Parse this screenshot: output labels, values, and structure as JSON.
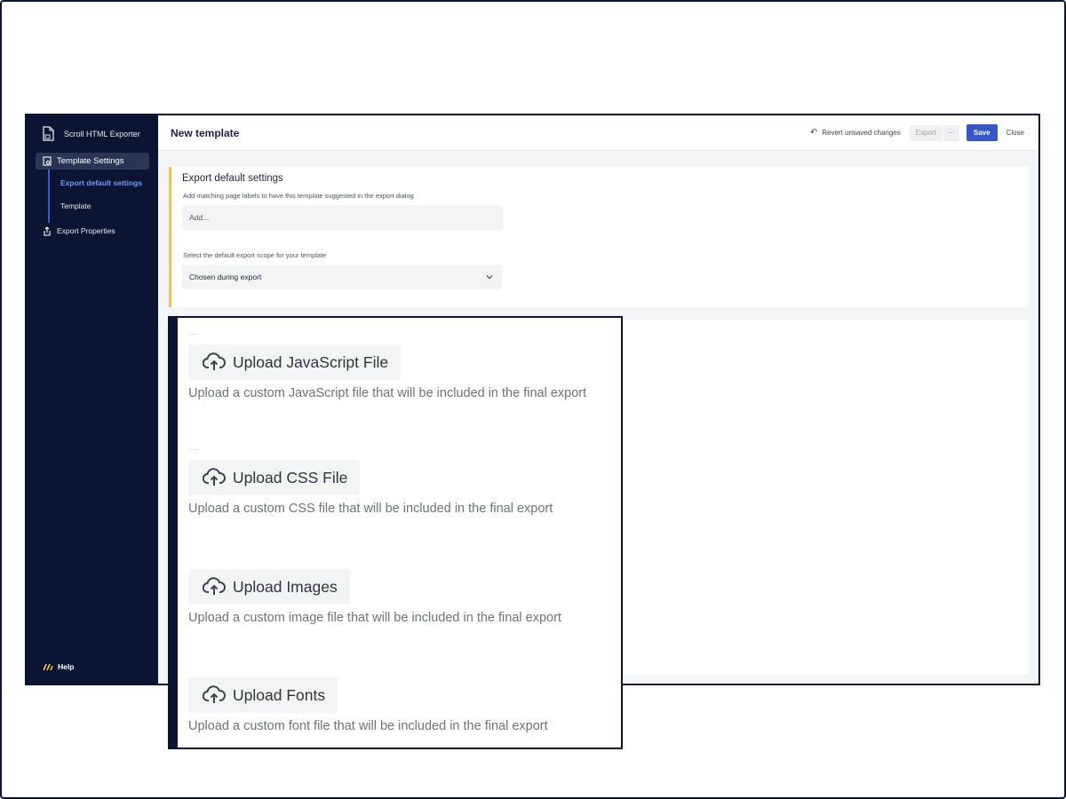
{
  "sidebar": {
    "app_name": "Scroll HTML Exporter",
    "nav_active": "Template Settings",
    "sub_items": [
      "Export default settings",
      "Template"
    ],
    "nav_export_properties": "Export Properties",
    "help": "Help"
  },
  "topbar": {
    "title": "New template",
    "revert": "Revert unsaved changes",
    "export": "Export",
    "more": "···",
    "save": "Save",
    "close": "Close"
  },
  "settings": {
    "title": "Export default settings",
    "labels_hint": "Add matching page labels to have this template suggested in the export dialog",
    "labels_placeholder": "Add...",
    "scope_hint": "Select the default export scope for your template",
    "scope_value": "Chosen during export"
  },
  "uploads": [
    {
      "label": "Upload JavaScript File",
      "desc": "Upload a custom JavaScript file that will be included in the final export"
    },
    {
      "label": "Upload CSS File",
      "desc": "Upload a custom CSS file that will be included in the final export"
    },
    {
      "label": "Upload Images",
      "desc": "Upload a custom image file that will be included in the final export"
    },
    {
      "label": "Upload Fonts",
      "desc": "Upload a custom font file that will be included in the final export"
    }
  ],
  "colors": {
    "sidebar_bg": "#0b1533",
    "accent": "#3356c9",
    "active_sub": "#6d9bff",
    "card_accent": "#f2c14e"
  },
  "icons": [
    "document-export-icon",
    "settings-page-icon",
    "export-icon",
    "help-logo-icon",
    "undo-icon",
    "chevron-down-icon",
    "cloud-upload-icon"
  ]
}
